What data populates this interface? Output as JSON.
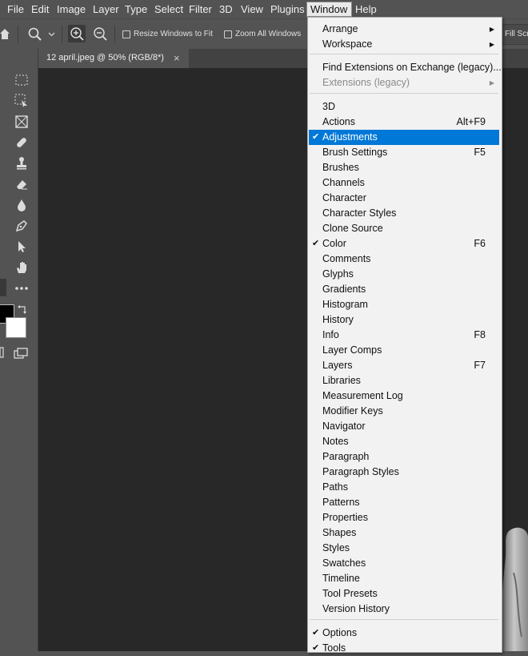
{
  "menubar": {
    "items": [
      "File",
      "Edit",
      "Image",
      "Layer",
      "Type",
      "Select",
      "Filter",
      "3D",
      "View",
      "Plugins",
      "Window",
      "Help"
    ]
  },
  "optionsbar": {
    "resize_windows_label": "Resize Windows to Fit",
    "zoom_all_label": "Zoom All Windows",
    "fill_screen_label": "Fill Scr"
  },
  "document_tab": {
    "title": "12 april.jpeg @ 50% (RGB/8*)",
    "close": "×"
  },
  "window_menu": {
    "items": [
      {
        "label": "Arrange",
        "submenu": true
      },
      {
        "label": "Workspace",
        "submenu": true
      },
      {
        "label": "Find Extensions on Exchange (legacy)..."
      },
      {
        "label": "Extensions (legacy)",
        "submenu": true,
        "disabled": true
      },
      {
        "label": "3D"
      },
      {
        "label": "Actions",
        "shortcut": "Alt+F9"
      },
      {
        "label": "Adjustments",
        "checked": true,
        "highlighted": true
      },
      {
        "label": "Brush Settings",
        "shortcut": "F5"
      },
      {
        "label": "Brushes"
      },
      {
        "label": "Channels"
      },
      {
        "label": "Character"
      },
      {
        "label": "Character Styles"
      },
      {
        "label": "Clone Source"
      },
      {
        "label": "Color",
        "shortcut": "F6",
        "checked": true
      },
      {
        "label": "Comments"
      },
      {
        "label": "Glyphs"
      },
      {
        "label": "Gradients"
      },
      {
        "label": "Histogram"
      },
      {
        "label": "History"
      },
      {
        "label": "Info",
        "shortcut": "F8"
      },
      {
        "label": "Layer Comps"
      },
      {
        "label": "Layers",
        "shortcut": "F7"
      },
      {
        "label": "Libraries"
      },
      {
        "label": "Measurement Log"
      },
      {
        "label": "Modifier Keys"
      },
      {
        "label": "Navigator"
      },
      {
        "label": "Notes"
      },
      {
        "label": "Paragraph"
      },
      {
        "label": "Paragraph Styles"
      },
      {
        "label": "Paths"
      },
      {
        "label": "Patterns"
      },
      {
        "label": "Properties"
      },
      {
        "label": "Shapes"
      },
      {
        "label": "Styles"
      },
      {
        "label": "Swatches"
      },
      {
        "label": "Timeline"
      },
      {
        "label": "Tool Presets"
      },
      {
        "label": "Version History"
      },
      {
        "label": "Options",
        "checked": true
      },
      {
        "label": "Tools",
        "checked": true
      }
    ]
  },
  "colors": {
    "menu_highlight": "#0078d7",
    "ui_gray": "#535353",
    "canvas": "#282828"
  }
}
